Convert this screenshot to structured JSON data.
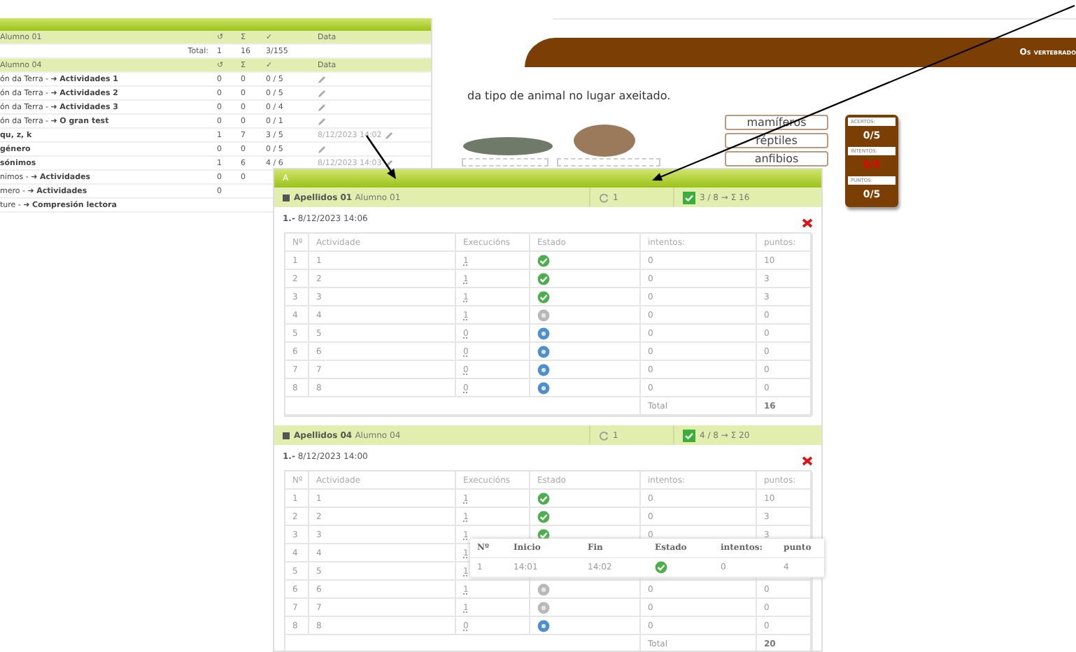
{
  "progress_table": {
    "sections": [
      {
        "student": "Alumno 01",
        "columns": [
          "↺",
          "Σ",
          "✓",
          "Data"
        ],
        "rows": [
          {
            "kind": "total",
            "name": "Total:",
            "attempts": "1",
            "sum": "16",
            "done": "3/155"
          }
        ]
      },
      {
        "student": "Alumno 04",
        "columns": [
          "↺",
          "Σ",
          "✓",
          "Data"
        ],
        "rows": [
          {
            "kind": "activity",
            "name": "ón da Terra - ➜ **Actividades 1**",
            "attempts": "0",
            "sum": "0",
            "done": "0 / 5",
            "edit_link": true
          },
          {
            "kind": "activity",
            "name": "ón da Terra - ➜ **Actividades 2**",
            "attempts": "0",
            "sum": "0",
            "done": "0 / 5",
            "edit_link": true
          },
          {
            "kind": "activity",
            "name": "ón da Terra - ➜ **Actividades 3**",
            "attempts": "0",
            "sum": "0",
            "done": "0 / 4",
            "edit_link": true
          },
          {
            "kind": "activity",
            "name": "ón da Terra - ➜ **O gran test**",
            "attempts": "0",
            "sum": "0",
            "done": "0 / 1",
            "edit_link": true
          },
          {
            "kind": "activity",
            "name": "**qu, z, k**",
            "attempts": "1",
            "sum": "7",
            "done": "3 / 5",
            "date": "8/12/2023 14:02",
            "edit_link": true
          },
          {
            "kind": "activity",
            "name": "**género**",
            "attempts": "0",
            "sum": "0",
            "done": "0 / 5",
            "edit_link": true
          },
          {
            "kind": "activity",
            "name": "**sónimos**",
            "attempts": "1",
            "sum": "6",
            "done": "4 / 6",
            "date": "8/12/2023 14:03",
            "edit_link": true
          },
          {
            "kind": "activity",
            "name": "nimos - ➜ **Actividades**",
            "attempts": "0",
            "sum": "0",
            "edit_link": false
          },
          {
            "kind": "activity",
            "name": "mero - ➜ **Actividades**",
            "attempts": "0",
            "edit_link": false
          },
          {
            "kind": "activity",
            "name": "ture - ➜ **Compresión lectora**",
            "edit_link": false
          }
        ]
      }
    ]
  },
  "exercise": {
    "title": "Os vertebrado",
    "instruction": "da tipo de animal no lugar axeitado.",
    "words": [
      "mamíferos",
      "réptiles",
      "anfibios"
    ],
    "score": [
      {
        "label": "ACERTOS:",
        "value": "0/5",
        "alert": false
      },
      {
        "label": "INTENTOS:",
        "value": "0/5",
        "alert": true
      },
      {
        "label": "PUNTOS:",
        "value": "0/5",
        "alert": false
      }
    ]
  },
  "results": {
    "group": "A",
    "students": [
      {
        "surname": "Apellidos 01",
        "name": "Alumno 01",
        "attempts": "1",
        "passed": true,
        "score": "3 / 8 → Σ 16",
        "session": "**1.-** 8/12/2023 14:06",
        "columns": [
          "Nº",
          "Actividade",
          "Execucións",
          "Estado",
          "intentos:",
          "puntos:"
        ],
        "rows": [
          {
            "n": "1",
            "activity": "1",
            "runs": "1",
            "completed": true,
            "tries": "0",
            "points": "10"
          },
          {
            "n": "2",
            "activity": "2",
            "runs": "1",
            "completed": true,
            "tries": "0",
            "points": "3"
          },
          {
            "n": "3",
            "activity": "3",
            "runs": "1",
            "completed": true,
            "tries": "0",
            "points": "3"
          },
          {
            "n": "4",
            "activity": "4",
            "runs": "1",
            "completed": false,
            "started": true,
            "tries": "0",
            "points": "0"
          },
          {
            "n": "5",
            "activity": "5",
            "runs": "0",
            "completed": false,
            "started": false,
            "tries": "0",
            "points": "0"
          },
          {
            "n": "6",
            "activity": "6",
            "runs": "0",
            "completed": false,
            "started": false,
            "tries": "0",
            "points": "0"
          },
          {
            "n": "7",
            "activity": "7",
            "runs": "0",
            "completed": false,
            "started": false,
            "tries": "0",
            "points": "0"
          },
          {
            "n": "8",
            "activity": "8",
            "runs": "0",
            "completed": false,
            "started": false,
            "tries": "0",
            "points": "0"
          }
        ],
        "total_label": "Total",
        "total": "16"
      },
      {
        "surname": "Apellidos 04",
        "name": "Alumno 04",
        "attempts": "1",
        "passed": true,
        "score": "4 / 8 → Σ 20",
        "session": "**1.-** 8/12/2023 14:00",
        "columns": [
          "Nº",
          "Actividade",
          "Execucións",
          "Estado",
          "intentos:",
          "puntos:"
        ],
        "rows": [
          {
            "n": "1",
            "activity": "1",
            "runs": "1",
            "completed": true,
            "tries": "0",
            "points": "10"
          },
          {
            "n": "2",
            "activity": "2",
            "runs": "1",
            "completed": true,
            "tries": "0",
            "points": "3"
          },
          {
            "n": "3",
            "activity": "3",
            "runs": "1",
            "completed": true,
            "tries": "0",
            "points": "3"
          },
          {
            "n": "4",
            "activity": "4",
            "runs": "1"
          },
          {
            "n": "5",
            "activity": "5",
            "runs": "1"
          },
          {
            "n": "6",
            "activity": "6",
            "runs": "1",
            "completed": false,
            "started": true,
            "tries": "0",
            "points": "0"
          },
          {
            "n": "7",
            "activity": "7",
            "runs": "1",
            "completed": false,
            "started": true,
            "tries": "0",
            "points": "0"
          },
          {
            "n": "8",
            "activity": "8",
            "runs": "0",
            "completed": false,
            "started": false,
            "tries": "0",
            "points": "0"
          }
        ],
        "total_label": "Total",
        "total": "20"
      }
    ]
  },
  "attempt_popup": {
    "columns": [
      "Nº",
      "Inicio",
      "Fin",
      "Estado",
      "intentos:",
      "punto"
    ],
    "rows": [
      {
        "n": "1",
        "start": "14:01",
        "end": "14:02",
        "completed": true,
        "tries": "0",
        "points": "4"
      }
    ]
  }
}
